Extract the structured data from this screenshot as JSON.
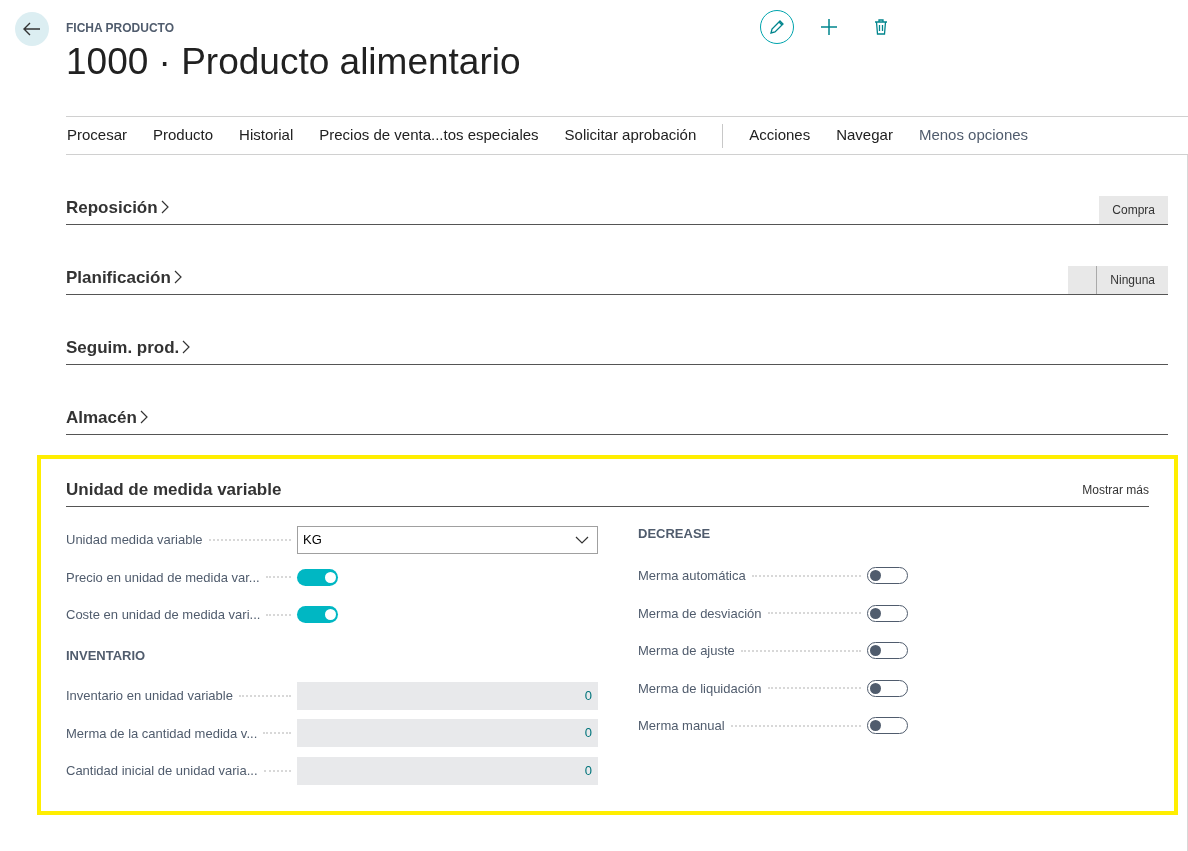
{
  "header": {
    "breadcrumb": "FICHA PRODUCTO",
    "title": "1000 · Producto alimentario"
  },
  "action_bar": {
    "groups": [
      [
        "Procesar",
        "Producto",
        "Historial",
        "Precios de venta...tos especiales",
        "Solicitar aprobación"
      ],
      [
        "Acciones",
        "Navegar"
      ]
    ],
    "more_link": "Menos opciones"
  },
  "collapsed_sections": [
    {
      "title": "Reposición",
      "empty_chip_before": false,
      "summary": "Compra"
    },
    {
      "title": "Planificación",
      "empty_chip_before": true,
      "summary": "Ninguna"
    },
    {
      "title": "Seguim. prod.",
      "empty_chip_before": false
    },
    {
      "title": "Almacén",
      "empty_chip_before": false
    }
  ],
  "expanded_section": {
    "title": "Unidad de medida variable",
    "show_more": "Mostrar más",
    "left_fields": [
      {
        "kind": "dropdown",
        "label": "Unidad medida variable",
        "value": "KG"
      },
      {
        "kind": "toggle",
        "label": "Precio en unidad de medida var...",
        "on": true
      },
      {
        "kind": "toggle",
        "label": "Coste en unidad de medida vari...",
        "on": true
      }
    ],
    "inventory": {
      "heading": "INVENTARIO",
      "fields": [
        {
          "label": "Inventario en unidad variable",
          "value": "0"
        },
        {
          "label": "Merma de la cantidad medida v...",
          "value": "0"
        },
        {
          "label": "Cantidad inicial de unidad varia...",
          "value": "0"
        }
      ]
    },
    "decrease": {
      "heading": "DECREASE",
      "fields": [
        {
          "label": "Merma automática",
          "on": false
        },
        {
          "label": "Merma de desviación",
          "on": false
        },
        {
          "label": "Merma de ajuste",
          "on": false
        },
        {
          "label": "Merma de liquidación",
          "on": false
        },
        {
          "label": "Merma manual",
          "on": false
        }
      ]
    }
  }
}
